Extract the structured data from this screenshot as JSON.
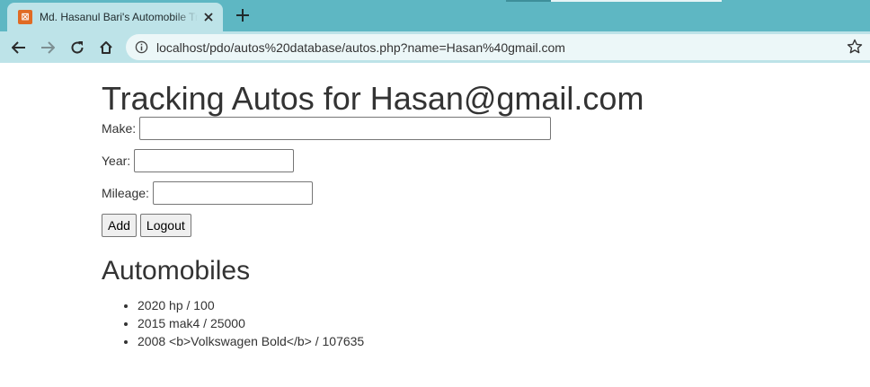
{
  "browser": {
    "tab_title": "Md. Hasanul Bari's Automobile Tracker",
    "favicon_glyph": "⊠",
    "url": "localhost/pdo/autos%20database/autos.php?name=Hasan%40gmail.com",
    "colors": {
      "tabstrip": "#5eb7c3",
      "toolbar": "#bde3e8",
      "omnibox": "#ecf7f8",
      "favicon": "#e06b24"
    },
    "icons": [
      "back-icon",
      "forward-icon",
      "reload-icon",
      "home-icon",
      "info-icon",
      "star-icon",
      "close-icon",
      "plus-icon"
    ]
  },
  "page": {
    "heading": "Tracking Autos for Hasan@gmail.com",
    "form": {
      "make_label": "Make:",
      "make_value": "",
      "year_label": "Year:",
      "year_value": "",
      "mileage_label": "Mileage:",
      "mileage_value": "",
      "add_label": "Add",
      "logout_label": "Logout"
    },
    "list_heading": "Automobiles",
    "autos": [
      "2020 hp / 100",
      "2015 mak4 / 25000",
      "2008 <b>Volkswagen Bold</b> / 107635"
    ]
  }
}
